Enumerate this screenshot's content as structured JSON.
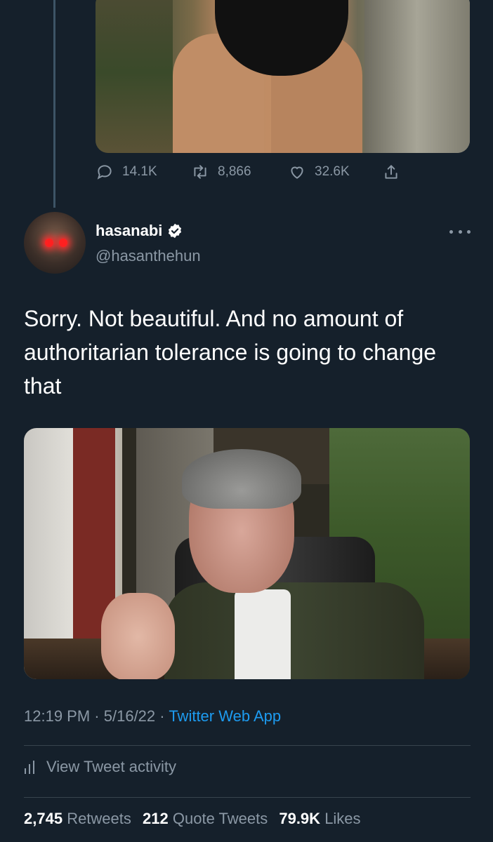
{
  "previous_tweet": {
    "replies": "14.1K",
    "retweets": "8,866",
    "likes": "32.6K"
  },
  "tweet": {
    "display_name": "hasanabi",
    "handle": "@hasanthehun",
    "text": "Sorry. Not beautiful. And no amount of authoritarian tolerance is going to change that",
    "time": "12:19 PM",
    "date": "5/16/22",
    "source": "Twitter Web App",
    "view_activity": "View Tweet activity",
    "stats": {
      "retweets_count": "2,745",
      "retweets_label": "Retweets",
      "quotes_count": "212",
      "quotes_label": "Quote Tweets",
      "likes_count": "79.9K",
      "likes_label": "Likes"
    }
  },
  "colors": {
    "background": "#15202b",
    "secondary_text": "#8b98a5",
    "link": "#1d9bf0",
    "divider": "#38444d"
  },
  "icons": [
    "reply-icon",
    "retweet-icon",
    "like-icon",
    "share-icon",
    "verified-icon",
    "more-icon",
    "activity-icon"
  ]
}
